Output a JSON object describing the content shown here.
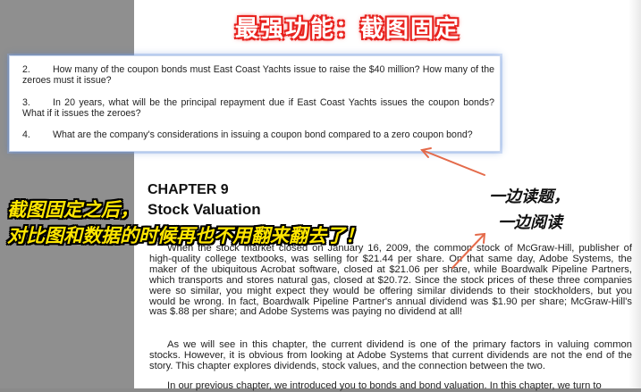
{
  "banner": {
    "text": "最强功能：截图固定"
  },
  "pinned_screenshot": {
    "questions": [
      {
        "number": "2.",
        "text": "How many of the coupon bonds must East Coast Yachts issue to raise the $40 million? How many of the zeroes must it issue?"
      },
      {
        "number": "3.",
        "text": "In 20 years, what will be the principal repayment due if East Coast Yachts issues the coupon bonds? What if it issues the zeroes?"
      },
      {
        "number": "4.",
        "text": "What are the company's considerations in issuing a coupon bond compared to a zero coupon bond?"
      }
    ]
  },
  "document": {
    "chapter": "CHAPTER 9",
    "title": "Stock Valuation",
    "paragraphs": [
      "When the stock market closed on January 16, 2009, the common stock of McGraw-Hill, publisher of high-quality college textbooks, was selling for $21.44 per share. On that same day, Adobe Systems, the maker of the ubiquitous Acrobat software, closed at $21.06 per share, while Boardwalk Pipeline Partners, which transports and stores natural gas, closed at $20.72. Since the stock prices of these three companies were so similar, you might expect they would be offering similar dividends to their stockholders, but you would be wrong. In fact, Boardwalk Pipeline Partner's annual dividend was $1.90 per share; McGraw-Hill's was $.88 per share; and Adobe Systems was paying no dividend at all!",
      "As we will see in this chapter, the current dividend is one of the primary factors in valuing common stocks. However, it is obvious from looking at Adobe Systems that current dividends are not the end of the story. This chapter explores dividends, stock values, and the connection between the two.",
      "In our previous chapter, we introduced you to bonds and bond valuation. In this chapter, we turn to"
    ]
  },
  "overlay": {
    "left_line1": "截图固定之后，",
    "left_line2": "对比图和数据的时候再也不用翻来翻去了！",
    "right_line1": "一边读题，",
    "right_line2": "一边阅读"
  },
  "colors": {
    "overlay_text": "#ffe600",
    "banner_glow": "#e8231f",
    "arrow": "#e46a4a"
  }
}
